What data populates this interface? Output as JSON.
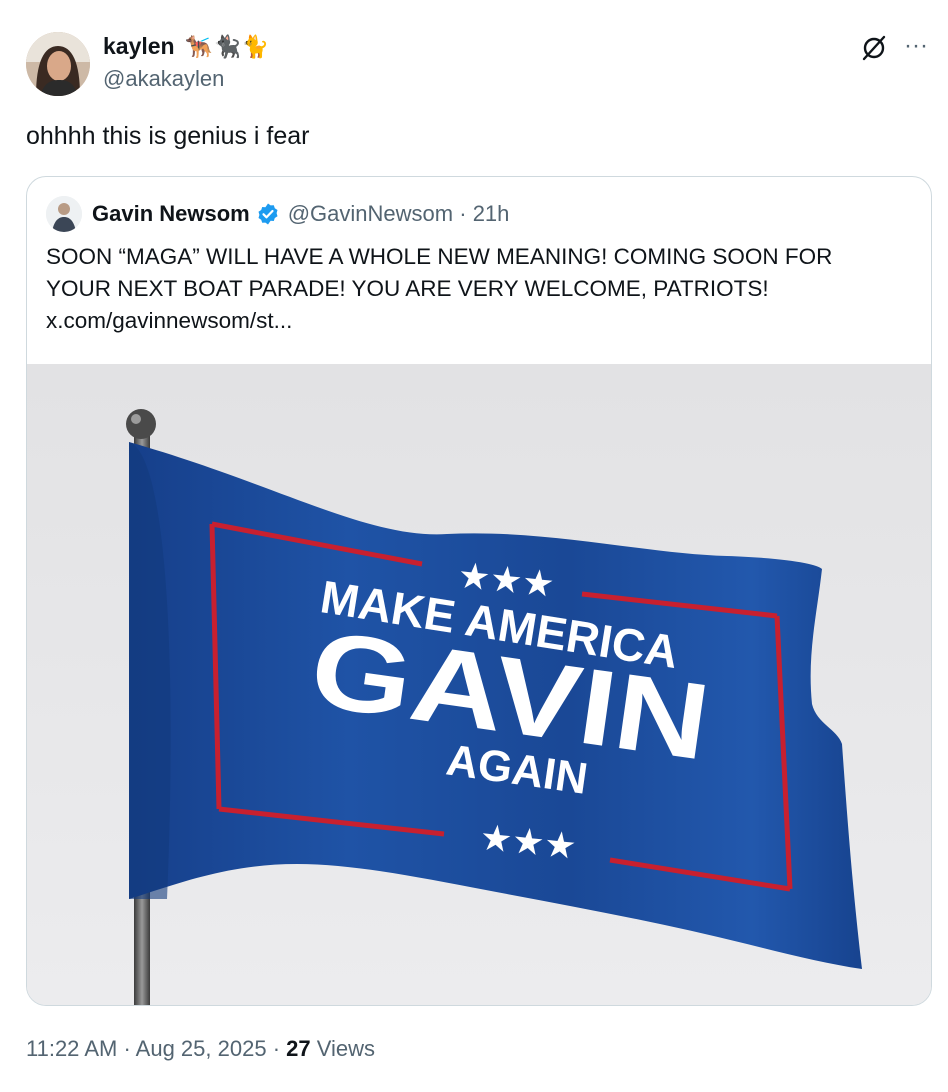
{
  "author": {
    "display_name": "kaylen",
    "emojis": "🐕‍🦺🐈‍⬛🐈",
    "handle": "@akakaylen"
  },
  "tweet": {
    "text": "ohhhh this is genius i fear"
  },
  "quoted": {
    "display_name": "Gavin Newsom",
    "verified": true,
    "handle": "@GavinNewsom",
    "separator": "·",
    "age": "21h",
    "lines": [
      "SOON “MAGA” WILL HAVE A WHOLE NEW MEANING! COMING SOON FOR",
      "YOUR NEXT BOAT PARADE! YOU ARE VERY WELCOME, PATRIOTS!",
      "x.com/gavinnewsom/st..."
    ],
    "image": {
      "line1": "MAKE AMERICA",
      "line2": "GAVIN",
      "line3": "AGAIN",
      "stars": "★★★"
    }
  },
  "meta": {
    "time": "11:22 AM",
    "sep1": " · ",
    "date": "Aug 25, 2025",
    "sep2": " · ",
    "views_count": "27",
    "views_label": " Views"
  },
  "colors": {
    "text": "#0f1419",
    "secondary": "#536471",
    "verified": "#1d9bf0",
    "flag_blue": "#1c4fa0",
    "flag_red": "#c8202f",
    "image_bg": "#e6e6e8"
  },
  "icons": [
    "grok-icon",
    "more-icon",
    "verified-icon"
  ]
}
